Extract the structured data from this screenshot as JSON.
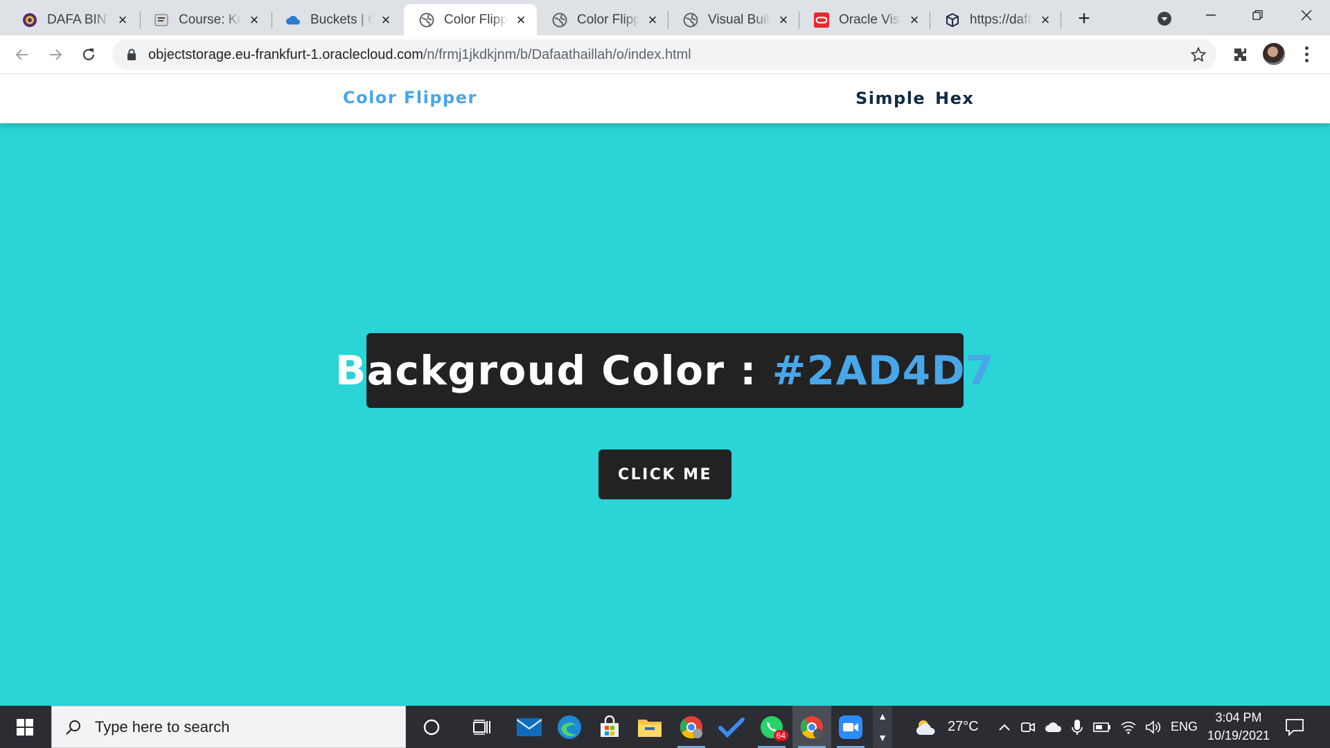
{
  "browser": {
    "tabs": [
      {
        "title": "DAFA BINTA",
        "icon": "university-seal-icon"
      },
      {
        "title": "Course: Kon",
        "icon": "course-icon"
      },
      {
        "title": "Buckets | Or",
        "icon": "oracle-cloud-icon"
      },
      {
        "title": "Color Flippe",
        "icon": "globe-icon",
        "active": true
      },
      {
        "title": "Color Flippe",
        "icon": "globe-icon"
      },
      {
        "title": "Visual Build",
        "icon": "globe-icon"
      },
      {
        "title": "Oracle Visu",
        "icon": "oracle-icon"
      },
      {
        "title": "https://dafa",
        "icon": "cube-icon"
      }
    ],
    "new_tab": "+",
    "url": {
      "host": "objectstorage.eu-frankfurt-1.oraclecloud.com",
      "path": "/n/frmj1jkdkjnm/b/Dafaathaillah/o/index.html"
    }
  },
  "site": {
    "brand": "Color Flipper",
    "nav_links": [
      "Simple",
      "Hex"
    ],
    "color_label": "Backgroud Color :",
    "color_value": "#2AD4D7",
    "button_label": "CLICK ME",
    "background_color": "#2ad4d7",
    "accent_color": "#49a6e9"
  },
  "taskbar": {
    "search_placeholder": "Type here to search",
    "badge_count": "64",
    "weather": "27°C",
    "language": "ENG",
    "time": "3:04 PM",
    "date": "10/19/2021"
  }
}
